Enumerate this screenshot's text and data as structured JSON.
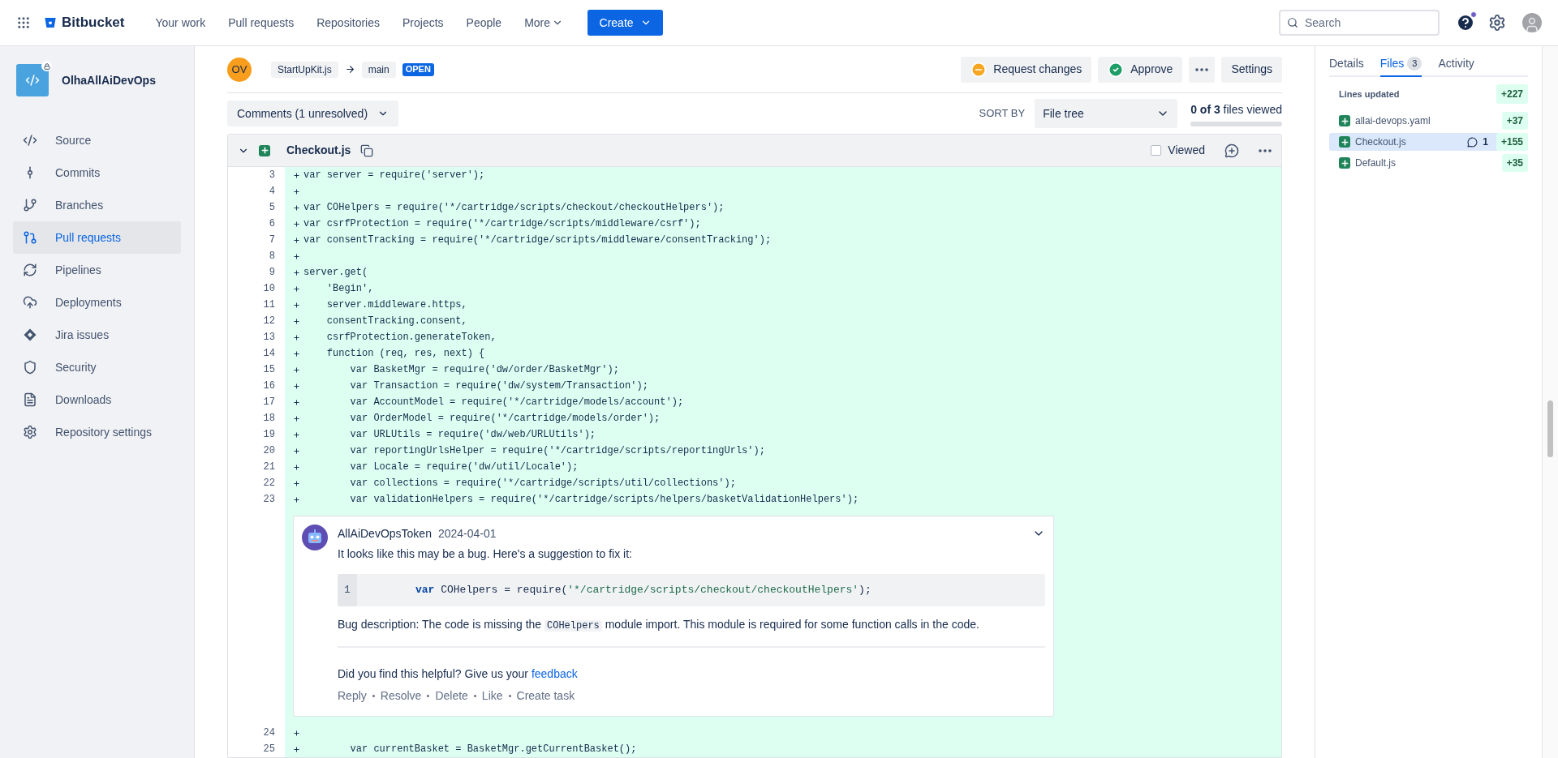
{
  "topbar": {
    "product": "Bitbucket",
    "nav": [
      {
        "label": "Your work",
        "kind": "link"
      },
      {
        "label": "Pull requests",
        "kind": "link"
      },
      {
        "label": "Repositories",
        "kind": "link"
      },
      {
        "label": "Projects",
        "kind": "link"
      },
      {
        "label": "People",
        "kind": "link"
      },
      {
        "label": "More",
        "kind": "menu"
      }
    ],
    "create": "Create",
    "search": {
      "placeholder": "Search"
    },
    "help_notification": true
  },
  "sidebar": {
    "repo": "OlhaAllAiDevOps",
    "private": true,
    "items": [
      {
        "label": "Source",
        "selected": false
      },
      {
        "label": "Commits",
        "selected": false
      },
      {
        "label": "Branches",
        "selected": false
      },
      {
        "label": "Pull requests",
        "selected": true
      },
      {
        "label": "Pipelines",
        "selected": false
      },
      {
        "label": "Deployments",
        "selected": false
      },
      {
        "label": "Jira issues",
        "selected": false
      },
      {
        "label": "Security",
        "selected": false
      },
      {
        "label": "Downloads",
        "selected": false
      },
      {
        "label": "Repository settings",
        "selected": false
      }
    ]
  },
  "pr": {
    "author_initials": "OV",
    "source_branch": "StartUpKit.js",
    "target_branch": "main",
    "state": "OPEN",
    "actions": [
      "Request changes",
      "Approve"
    ],
    "settings": "Settings"
  },
  "toolbar": {
    "comments_filter": "Comments (1 unresolved)",
    "sort_label": "SORT BY",
    "sort_value": "File tree",
    "viewed_text": "**0 of 3** files viewed",
    "viewed": {
      "level": 0
    }
  },
  "file": {
    "name": "Checkout.js",
    "viewed_label": "Viewed",
    "viewed_checked": false,
    "expanded": true,
    "lines_before": [
      {
        "number": "3",
        "text": "var server = require('server');"
      },
      {
        "number": "4"
      },
      {
        "number": "5",
        "text": "var COHelpers = require('*/cartridge/scripts/checkout/checkoutHelpers');"
      },
      {
        "number": "6",
        "text": "var csrfProtection = require('*/cartridge/scripts/middleware/csrf');"
      },
      {
        "number": "7",
        "text": "var consentTracking = require('*/cartridge/scripts/middleware/consentTracking');"
      },
      {
        "number": "8"
      },
      {
        "number": "9",
        "text": "server.get("
      },
      {
        "number": "10",
        "text": "    'Begin',"
      },
      {
        "number": "11",
        "text": "    server.middleware.https,"
      },
      {
        "number": "12",
        "text": "    consentTracking.consent,"
      },
      {
        "number": "13",
        "text": "    csrfProtection.generateToken,"
      },
      {
        "number": "14",
        "text": "    function (req, res, next) {"
      },
      {
        "number": "15",
        "text": "        var BasketMgr = require('dw/order/BasketMgr');"
      },
      {
        "number": "16",
        "text": "        var Transaction = require('dw/system/Transaction');"
      },
      {
        "number": "17",
        "text": "        var AccountModel = require('*/cartridge/models/account');"
      },
      {
        "number": "18",
        "text": "        var OrderModel = require('*/cartridge/models/order');"
      },
      {
        "number": "19",
        "text": "        var URLUtils = require('dw/web/URLUtils');"
      },
      {
        "number": "20",
        "text": "        var reportingUrlsHelper = require('*/cartridge/scripts/reportingUrls');"
      },
      {
        "number": "21",
        "text": "        var Locale = require('dw/util/Locale');"
      },
      {
        "number": "22",
        "text": "        var collections = require('*/cartridge/scripts/util/collections');"
      },
      {
        "number": "23",
        "text": "        var validationHelpers = require('*/cartridge/scripts/helpers/basketValidationHelpers');"
      }
    ],
    "comment": {
      "author": "AllAiDevOpsToken",
      "date": "2024-04-01",
      "intro": "It looks like this may be a bug. Here's a suggestion to fix it:",
      "suggestion": {
        "number": "1",
        "parts": [
          {
            "kind": "keyword",
            "text": "var"
          },
          {
            "kind": "plain",
            "text": " COHelpers = require("
          },
          {
            "kind": "string",
            "text": "'*/cartridge/scripts/checkout/checkoutHelpers'"
          },
          {
            "kind": "plain",
            "text": ");"
          }
        ]
      },
      "description": [
        {
          "kind": "plain",
          "text": "Bug description: The code is missing the "
        },
        {
          "kind": "code",
          "text": "COHelpers"
        },
        {
          "kind": "plain",
          "text": " module import. This module is required for some function calls in the code."
        }
      ],
      "feedback_prompt": "Did you find this helpful? Give us your ",
      "feedback_link": "feedback",
      "actions": [
        "Reply",
        "Resolve",
        "Delete",
        "Like",
        "Create task"
      ]
    },
    "lines_after": [
      {
        "number": "24"
      },
      {
        "number": "25",
        "text": "        var currentBasket = BasketMgr.getCurrentBasket();"
      }
    ]
  },
  "panel": {
    "tabs": [
      {
        "label": "Details",
        "selected": false
      },
      {
        "label": "Files",
        "count": "3",
        "selected": true
      },
      {
        "label": "Activity",
        "selected": false
      }
    ],
    "lines_updated_label": "Lines updated",
    "lines_updated": "+227",
    "files": [
      {
        "name": "allai-devops.yaml",
        "added": "+37",
        "selected": false
      },
      {
        "name": "Checkout.js",
        "comments": "1",
        "added": "+155",
        "selected": true
      },
      {
        "name": "Default.js",
        "added": "+35",
        "selected": false
      }
    ]
  }
}
